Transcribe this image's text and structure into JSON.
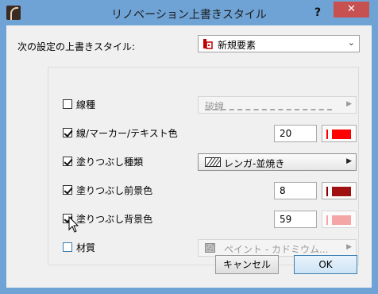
{
  "window": {
    "title": "リノベーション上書きスタイル",
    "help_label": "?",
    "close_label": "✕"
  },
  "override_style": {
    "label": "次の設定の上書きスタイル:",
    "value": "新規要素",
    "icon": "building-icon"
  },
  "rows": [
    {
      "name": "line-type",
      "label": "線種",
      "checked": false,
      "control": "combo",
      "value": "破線",
      "enabled": false
    },
    {
      "name": "line-marker-text-color",
      "label": "線/マーカー/テキスト色",
      "checked": true,
      "control": "number-color",
      "value": "20",
      "color": "#ff0000"
    },
    {
      "name": "fill-type",
      "label": "塗りつぶし種類",
      "checked": true,
      "control": "combo",
      "value": "レンガ-並焼き",
      "enabled": true
    },
    {
      "name": "fill-foreground-color",
      "label": "塗りつぶし前景色",
      "checked": true,
      "control": "number-color",
      "value": "8",
      "color": "#a01010"
    },
    {
      "name": "fill-background-color",
      "label": "塗りつぶし背景色",
      "checked": true,
      "control": "number-color",
      "value": "59",
      "color": "#f4a6a6",
      "disabled": true
    },
    {
      "name": "material",
      "label": "材質",
      "checked": false,
      "control": "combo",
      "value": "ペイント - カドミウム...",
      "enabled": false
    }
  ],
  "buttons": {
    "cancel": "キャンセル",
    "ok": "OK"
  },
  "colors": {
    "titlebar": "#6fa3d6",
    "close": "#c75050",
    "accent_red": "#ff0000"
  }
}
